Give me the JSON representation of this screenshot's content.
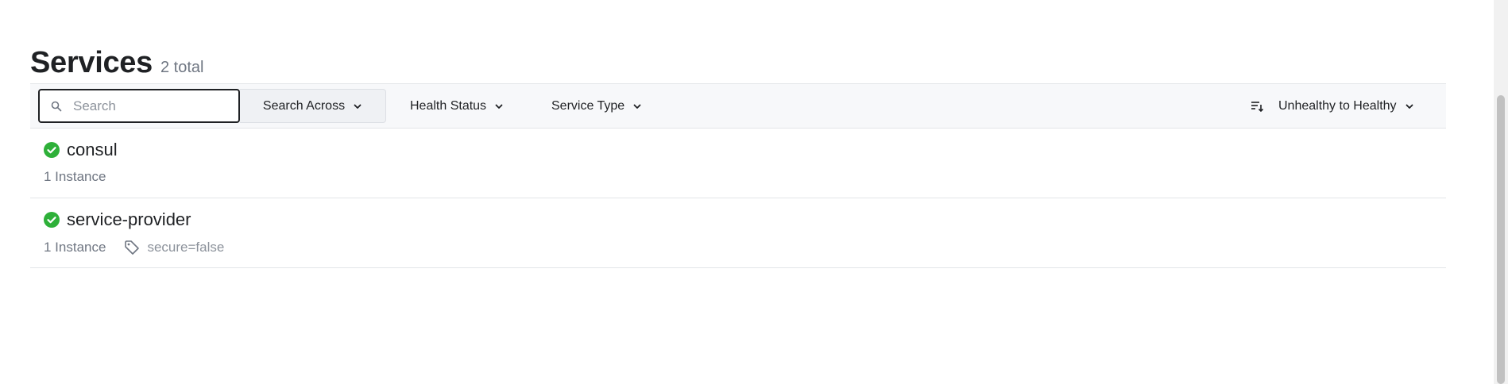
{
  "header": {
    "title": "Services",
    "count": "2 total"
  },
  "toolbar": {
    "search_placeholder": "Search",
    "search_value": "",
    "search_across_label": "Search Across",
    "health_status_label": "Health Status",
    "service_type_label": "Service Type",
    "sort_label": "Unhealthy to Healthy"
  },
  "services": [
    {
      "name": "consul",
      "status": "passing",
      "instances": "1 Instance",
      "tags": []
    },
    {
      "name": "service-provider",
      "status": "passing",
      "instances": "1 Instance",
      "tags": [
        "secure=false"
      ]
    }
  ],
  "colors": {
    "passing": "#2eb039",
    "text": "#1f2124",
    "muted": "#6f7682"
  },
  "icons": {
    "search": "search-icon",
    "chevron": "chevron-down-icon",
    "sort": "sort-icon",
    "status": "check-circle-icon",
    "tag": "tag-icon"
  }
}
